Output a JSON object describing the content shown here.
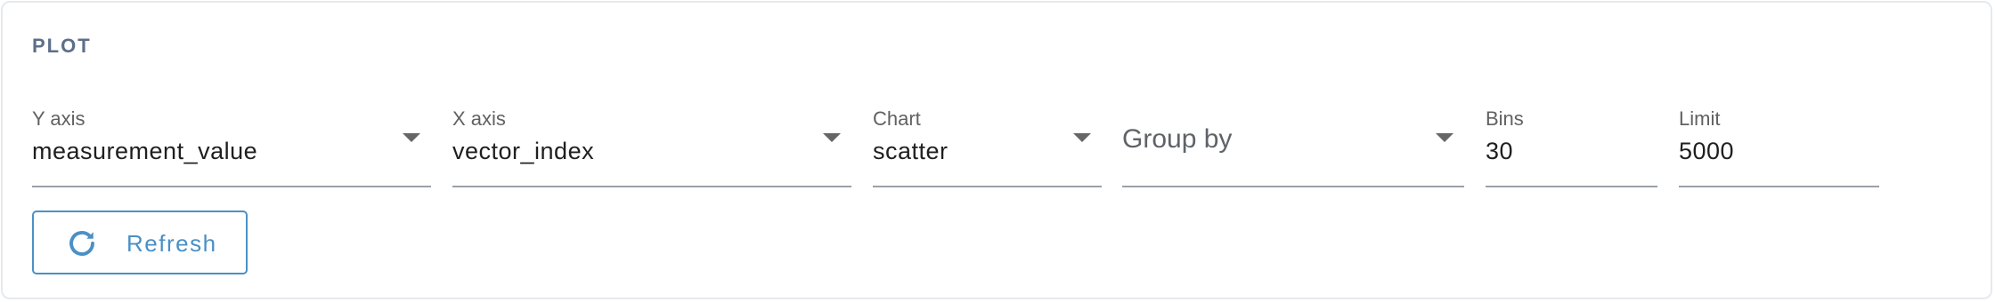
{
  "section": {
    "title": "PLOT"
  },
  "fields": {
    "y_axis": {
      "label": "Y axis",
      "value": "measurement_value"
    },
    "x_axis": {
      "label": "X axis",
      "value": "vector_index"
    },
    "chart": {
      "label": "Chart",
      "value": "scatter"
    },
    "group_by": {
      "placeholder": "Group by"
    },
    "bins": {
      "label": "Bins",
      "value": "30"
    },
    "limit": {
      "label": "Limit",
      "value": "5000"
    }
  },
  "actions": {
    "refresh_label": "Refresh"
  },
  "colors": {
    "accent": "#4a90c6",
    "title": "#5c6f8a",
    "underline": "#9aa0a6"
  },
  "icons": {
    "dropdown": "caret-down-icon",
    "refresh": "refresh-icon"
  }
}
